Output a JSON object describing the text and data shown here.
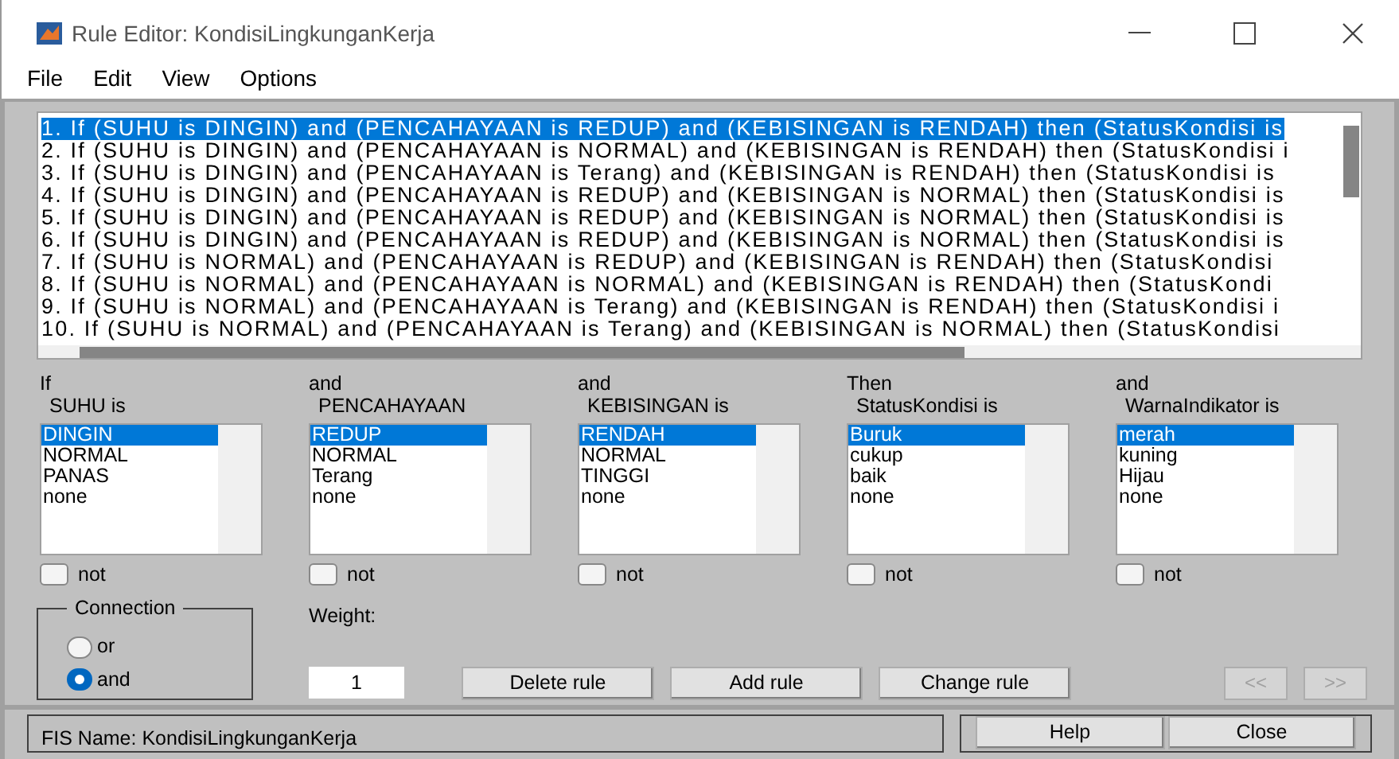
{
  "window": {
    "title": "Rule Editor: KondisiLingkunganKerja"
  },
  "menu": [
    "File",
    "Edit",
    "View",
    "Options"
  ],
  "rules": [
    {
      "text": "1. If (SUHU is DINGIN) and (PENCAHAYAAN is REDUP) and (KEBISINGAN is RENDAH) then (StatusKondisi is",
      "selected": true
    },
    {
      "text": "2. If (SUHU is DINGIN) and (PENCAHAYAAN is NORMAL) and (KEBISINGAN is RENDAH) then (StatusKondisi i",
      "selected": false
    },
    {
      "text": "3. If (SUHU is DINGIN) and (PENCAHAYAAN is Terang) and (KEBISINGAN is RENDAH) then (StatusKondisi is",
      "selected": false
    },
    {
      "text": "4. If (SUHU is DINGIN) and (PENCAHAYAAN is REDUP) and (KEBISINGAN is NORMAL) then (StatusKondisi is",
      "selected": false
    },
    {
      "text": "5. If (SUHU is DINGIN) and (PENCAHAYAAN is REDUP) and (KEBISINGAN is NORMAL) then (StatusKondisi is",
      "selected": false
    },
    {
      "text": "6. If (SUHU is DINGIN) and (PENCAHAYAAN is REDUP) and (KEBISINGAN is NORMAL) then (StatusKondisi is",
      "selected": false
    },
    {
      "text": "7. If (SUHU is NORMAL) and (PENCAHAYAAN is REDUP) and (KEBISINGAN is RENDAH) then (StatusKondisi",
      "selected": false
    },
    {
      "text": "8. If (SUHU is NORMAL) and (PENCAHAYAAN is NORMAL) and (KEBISINGAN is RENDAH) then (StatusKondi",
      "selected": false
    },
    {
      "text": "9. If (SUHU is NORMAL) and (PENCAHAYAAN is Terang) and (KEBISINGAN is RENDAH) then (StatusKondisi i",
      "selected": false
    },
    {
      "text": "10. If (SUHU is NORMAL) and (PENCAHAYAAN is Terang) and (KEBISINGAN is NORMAL) then (StatusKondisi",
      "selected": false
    }
  ],
  "columns": [
    {
      "connector": "If",
      "label": "SUHU is",
      "items": [
        {
          "text": "DINGIN",
          "selected": true
        },
        {
          "text": "NORMAL",
          "selected": false
        },
        {
          "text": "PANAS",
          "selected": false
        },
        {
          "text": "none",
          "selected": false
        }
      ],
      "not": {
        "label": "not",
        "checked": false
      }
    },
    {
      "connector": "and",
      "label": "PENCAHAYAAN",
      "items": [
        {
          "text": "REDUP",
          "selected": true
        },
        {
          "text": "NORMAL",
          "selected": false
        },
        {
          "text": "Terang",
          "selected": false
        },
        {
          "text": "none",
          "selected": false
        }
      ],
      "not": {
        "label": "not",
        "checked": false
      }
    },
    {
      "connector": "and",
      "label": "KEBISINGAN is",
      "items": [
        {
          "text": "RENDAH",
          "selected": true
        },
        {
          "text": "NORMAL",
          "selected": false
        },
        {
          "text": "TINGGI",
          "selected": false
        },
        {
          "text": "none",
          "selected": false
        }
      ],
      "not": {
        "label": "not",
        "checked": false
      }
    },
    {
      "connector": "Then",
      "label": "StatusKondisi is",
      "items": [
        {
          "text": "Buruk",
          "selected": true
        },
        {
          "text": "cukup",
          "selected": false
        },
        {
          "text": "baik",
          "selected": false
        },
        {
          "text": "none",
          "selected": false
        }
      ],
      "not": {
        "label": "not",
        "checked": false
      }
    },
    {
      "connector": "and",
      "label": "WarnaIndikator is",
      "items": [
        {
          "text": "merah",
          "selected": true
        },
        {
          "text": "kuning",
          "selected": false
        },
        {
          "text": "Hijau",
          "selected": false
        },
        {
          "text": "none",
          "selected": false
        }
      ],
      "not": {
        "label": "not",
        "checked": false
      }
    }
  ],
  "connection": {
    "title": "Connection",
    "options": [
      {
        "label": "or",
        "selected": false
      },
      {
        "label": "and",
        "selected": true
      }
    ]
  },
  "weight": {
    "label": "Weight:",
    "value": "1"
  },
  "rule_buttons": [
    {
      "label": "Delete rule",
      "disabled": false
    },
    {
      "label": "Add rule",
      "disabled": false
    },
    {
      "label": "Change rule",
      "disabled": false
    }
  ],
  "nav_buttons": [
    {
      "label": "<<",
      "disabled": true
    },
    {
      "label": ">>",
      "disabled": true
    }
  ],
  "status": {
    "text": "FIS Name: KondisiLingkunganKerja"
  },
  "footer_buttons": [
    {
      "label": "Help"
    },
    {
      "label": "Close"
    }
  ]
}
